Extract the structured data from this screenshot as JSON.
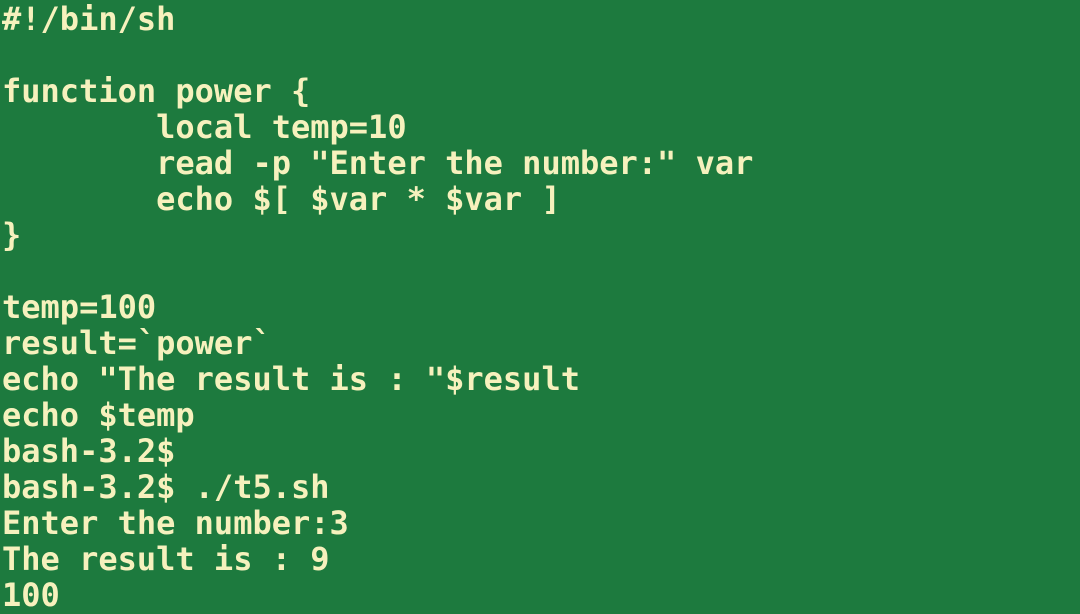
{
  "terminal": {
    "background_color": "#1d7a3e",
    "text_color": "#f6f1bd",
    "prompt": "bash-3.2$",
    "shell_version": "bash-3.2",
    "script_name": "./t5.sh",
    "lines": [
      {
        "id": "shebang",
        "text": "#!/bin/sh",
        "kind": "script"
      },
      {
        "id": "blank-1",
        "text": "",
        "kind": "blank"
      },
      {
        "id": "func-decl",
        "text": "function power {",
        "kind": "script"
      },
      {
        "id": "func-local-temp",
        "text": "        local temp=10",
        "kind": "script"
      },
      {
        "id": "func-read-var",
        "text": "        read -p \"Enter the number:\" var",
        "kind": "script"
      },
      {
        "id": "func-echo-square",
        "text": "        echo $[ $var * $var ]",
        "kind": "script"
      },
      {
        "id": "func-close",
        "text": "}",
        "kind": "script"
      },
      {
        "id": "blank-2",
        "text": "",
        "kind": "blank"
      },
      {
        "id": "set-temp",
        "text": "temp=100",
        "kind": "script"
      },
      {
        "id": "set-result",
        "text": "result=`power`",
        "kind": "script"
      },
      {
        "id": "echo-result",
        "text": "echo \"The result is : \"$result",
        "kind": "script"
      },
      {
        "id": "echo-temp",
        "text": "echo $temp",
        "kind": "script"
      },
      {
        "id": "prompt-empty",
        "text": "bash-3.2$",
        "kind": "prompt"
      },
      {
        "id": "prompt-run",
        "text": "bash-3.2$ ./t5.sh",
        "kind": "prompt"
      },
      {
        "id": "output-enter",
        "text": "Enter the number:3",
        "kind": "output"
      },
      {
        "id": "output-result",
        "text": "The result is : 9",
        "kind": "output"
      },
      {
        "id": "output-temp",
        "text": "100",
        "kind": "output"
      }
    ]
  }
}
